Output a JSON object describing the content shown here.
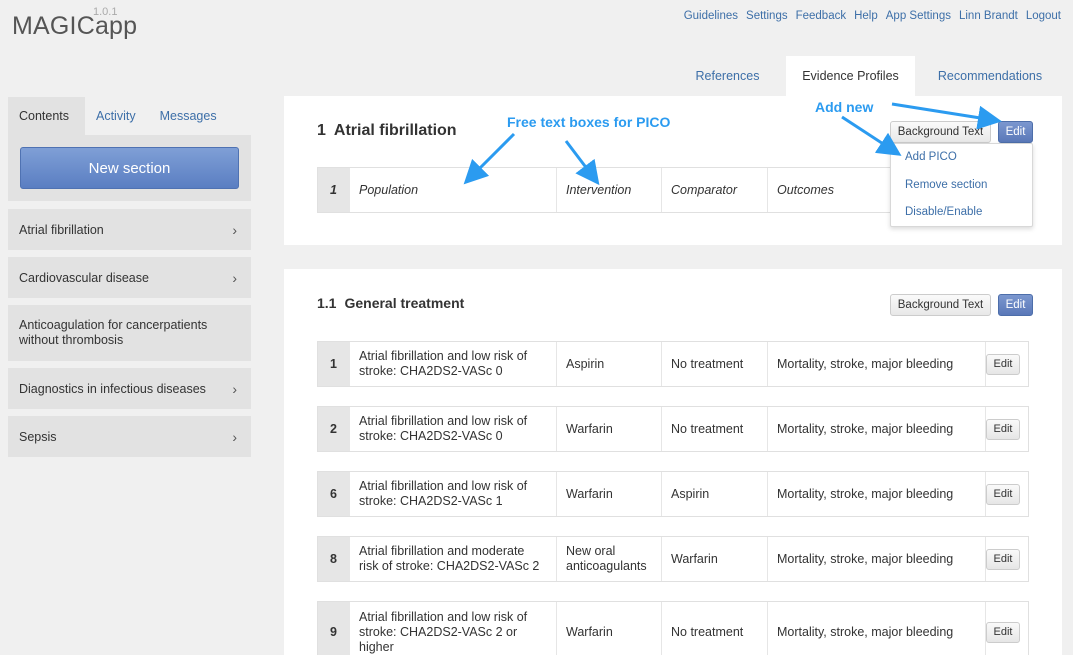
{
  "app": {
    "name": "MAGICapp",
    "version": "1.0.1"
  },
  "topnav": [
    "Guidelines",
    "Settings",
    "Feedback",
    "Help",
    "App Settings",
    "Linn Brandt",
    "Logout"
  ],
  "top_tabs": [
    {
      "label": "References",
      "active": false
    },
    {
      "label": "Evidence Profiles",
      "active": true
    },
    {
      "label": "Recommendations",
      "active": false
    }
  ],
  "sidebar": {
    "tabs": [
      {
        "label": "Contents",
        "active": true
      },
      {
        "label": "Activity",
        "active": false
      },
      {
        "label": "Messages",
        "active": false
      }
    ],
    "new_section_label": "New section",
    "items": [
      {
        "label": "Atrial fibrillation",
        "chevron": true
      },
      {
        "label": "Cardiovascular disease",
        "chevron": true
      },
      {
        "label": "Anticoagulation for cancerpatients without thrombosis",
        "chevron": false
      },
      {
        "label": "Diagnostics in infectious diseases",
        "chevron": true
      },
      {
        "label": "Sepsis",
        "chevron": true
      }
    ]
  },
  "section1": {
    "number": "1",
    "title": "Atrial fibrillation",
    "background_label": "Background Text",
    "edit_label": "Edit",
    "header_row": {
      "index": "1",
      "population": "Population",
      "intervention": "Intervention",
      "comparator": "Comparator",
      "outcomes": "Outcomes"
    },
    "dropdown": [
      "Add PICO",
      "Remove section",
      "Disable/Enable"
    ]
  },
  "section2": {
    "number": "1.1",
    "title": "General treatment",
    "background_label": "Background Text",
    "edit_label": "Edit",
    "rows": [
      {
        "index": "1",
        "population": "Atrial fibrillation and low risk of stroke: CHA2DS2-VASc 0",
        "intervention": "Aspirin",
        "comparator": "No treatment",
        "outcomes": "Mortality, stroke, major bleeding",
        "edit": "Edit"
      },
      {
        "index": "2",
        "population": "Atrial fibrillation and low risk of stroke: CHA2DS2-VASc 0",
        "intervention": "Warfarin",
        "comparator": "No treatment",
        "outcomes": "Mortality, stroke, major bleeding",
        "edit": "Edit"
      },
      {
        "index": "6",
        "population": "Atrial fibrillation and low risk of stroke: CHA2DS2-VASc 1",
        "intervention": "Warfarin",
        "comparator": "Aspirin",
        "outcomes": "Mortality, stroke, major bleeding",
        "edit": "Edit"
      },
      {
        "index": "8",
        "population": "Atrial fibrillation and moderate risk of stroke: CHA2DS2-VASc 2",
        "intervention": "New oral anticoagulants",
        "comparator": "Warfarin",
        "outcomes": "Mortality, stroke, major bleeding",
        "edit": "Edit"
      },
      {
        "index": "9",
        "population": "Atrial fibrillation and low risk of stroke: CHA2DS2-VASc 2 or higher",
        "intervention": "Warfarin",
        "comparator": "No treatment",
        "outcomes": "Mortality, stroke, major bleeding",
        "edit": "Edit"
      }
    ]
  },
  "annotations": {
    "free_text": "Free text boxes for PICO",
    "add_new": "Add new",
    "color": "#2b9bf0"
  }
}
